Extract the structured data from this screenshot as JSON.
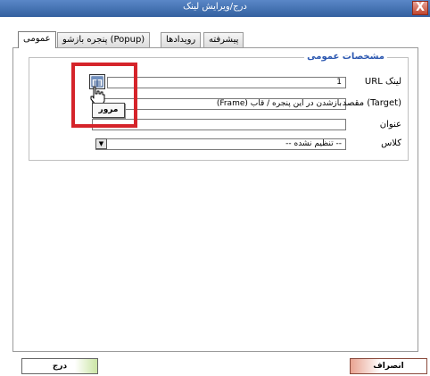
{
  "window": {
    "title": "درج/ویرایش لینک",
    "close_label": "X"
  },
  "tabs": [
    {
      "label": "عمومی"
    },
    {
      "label": "پنجره بازشو (Popup)"
    },
    {
      "label": "رویدادها"
    },
    {
      "label": "پیشرفته"
    }
  ],
  "section": {
    "legend": "مشخصات عمومی"
  },
  "fields": {
    "url": {
      "label": "URL لینک",
      "value": "1"
    },
    "target": {
      "label": "مقصد (Target)",
      "value": "بازشدن در این پنجره / قاب (Frame)"
    },
    "title": {
      "label": "عنوان",
      "value": ""
    },
    "class": {
      "label": "کلاس",
      "value": "-- تنظیم نشده --"
    }
  },
  "tooltip": {
    "text": "مرور"
  },
  "buttons": {
    "insert": "درج",
    "cancel": "انصراف"
  },
  "colors": {
    "highlight": "#d5242a",
    "titlebar": "#3a68aa",
    "legend": "#2b57b0"
  }
}
